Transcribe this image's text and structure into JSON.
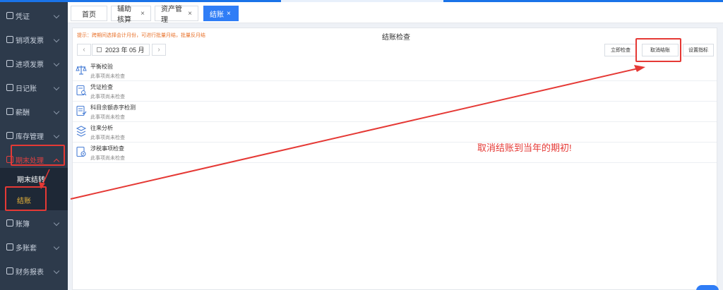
{
  "sidebar": {
    "items": [
      {
        "label": "凭证",
        "icon": "voucher-icon"
      },
      {
        "label": "销项发票",
        "icon": "invoice-out-icon"
      },
      {
        "label": "进项发票",
        "icon": "invoice-in-icon"
      },
      {
        "label": "日记账",
        "icon": "journal-icon"
      },
      {
        "label": "薪酬",
        "icon": "salary-icon"
      },
      {
        "label": "库存管理",
        "icon": "warehouse-icon"
      },
      {
        "label": "期末处理",
        "icon": "period-end-icon"
      },
      {
        "label": "账簿",
        "icon": "ledger-icon"
      },
      {
        "label": "多账套",
        "icon": "multi-book-icon"
      },
      {
        "label": "财务报表",
        "icon": "report-icon"
      }
    ],
    "subitems": [
      {
        "label": "期末结转"
      },
      {
        "label": "结账"
      }
    ]
  },
  "tabs": [
    {
      "label": "首页",
      "closable": false
    },
    {
      "label": "辅助核算",
      "closable": true
    },
    {
      "label": "资产管理",
      "closable": true
    },
    {
      "label": "结账",
      "closable": true,
      "active": true
    }
  ],
  "close_glyph": "×",
  "panel": {
    "hint": "提示：跨期间选择会计月份，可进行批量月结，批量反月结",
    "title": "结账检查",
    "period": "2023 年 05 月",
    "prev_glyph": "‹",
    "next_glyph": "›",
    "buttons": {
      "check": "立即检查",
      "cancel_close": "取消结账",
      "settings": "设置指标"
    },
    "rows": [
      {
        "title": "平衡校验",
        "status": "此事项尚未检查",
        "icon": "balance-scale-icon"
      },
      {
        "title": "凭证检查",
        "status": "此事项尚未检查",
        "icon": "voucher-search-icon"
      },
      {
        "title": "科目余额赤字检测",
        "status": "此事项尚未检查",
        "icon": "deficit-check-icon"
      },
      {
        "title": "往来分析",
        "status": "此事项尚未检查",
        "icon": "cubes-icon"
      },
      {
        "title": "涉税事项检查",
        "status": "此事项尚未检查",
        "icon": "tax-doc-icon"
      }
    ]
  },
  "annotation": "取消结账到当年的期初!",
  "colors": {
    "accent": "#2f7df6",
    "sidebar": "#2d3a4b",
    "highlight": "#e53935",
    "hint": "#e8712a"
  }
}
